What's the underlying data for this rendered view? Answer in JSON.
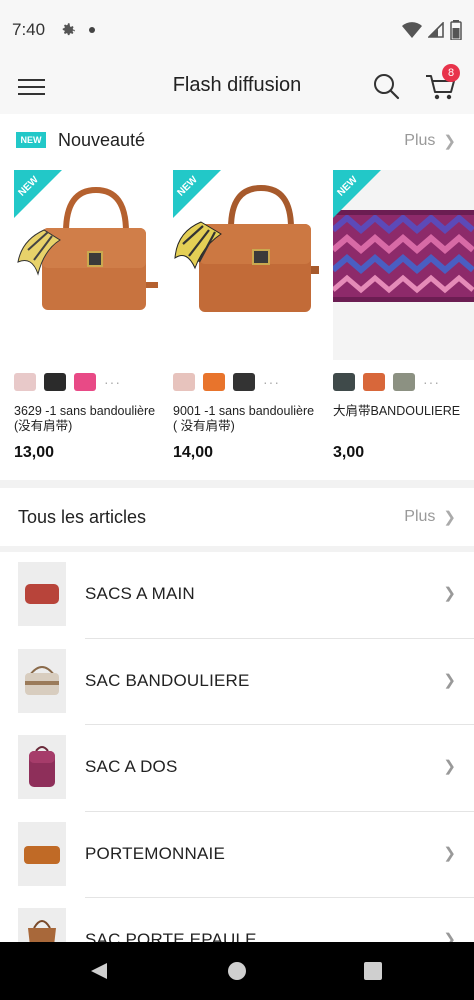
{
  "status": {
    "time": "7:40"
  },
  "app": {
    "title": "Flash diffusion",
    "cart_count": "8"
  },
  "new_section": {
    "tag": "NEW",
    "title": "Nouveauté",
    "more": "Plus",
    "corner_label": "NEW",
    "products": [
      {
        "name": "3629 -1 sans bandoulière (没有肩带)",
        "price": "13,00",
        "swatches": [
          "#e8c9c9",
          "#2b2b2b",
          "#e84a86"
        ],
        "more": "···"
      },
      {
        "name": "9001 -1  sans bandoulière ( 没有肩带)",
        "price": "14,00",
        "swatches": [
          "#e7c3bd",
          "#e8742c",
          "#333333"
        ],
        "more": "···"
      },
      {
        "name": "大肩带BANDOULIERE",
        "price": "3,00",
        "swatches": [
          "#3f4a4a",
          "#d8673a",
          "#8c9182"
        ],
        "more": "···"
      }
    ]
  },
  "articles": {
    "title": "Tous les articles",
    "more": "Plus",
    "categories": [
      {
        "label": "SACS A MAIN"
      },
      {
        "label": "SAC BANDOULIERE"
      },
      {
        "label": "SAC A DOS"
      },
      {
        "label": "PORTEMONNAIE"
      },
      {
        "label": "SAC PORTE EPAULE"
      }
    ]
  },
  "colors": {
    "accent": "#22c8c8",
    "badge": "#e8334b"
  },
  "icons": [
    "gear-icon",
    "wifi-icon",
    "signal-icon",
    "battery-icon",
    "menu-icon",
    "search-icon",
    "cart-icon",
    "chevron-right-icon",
    "back-icon",
    "home-icon",
    "recents-icon"
  ]
}
